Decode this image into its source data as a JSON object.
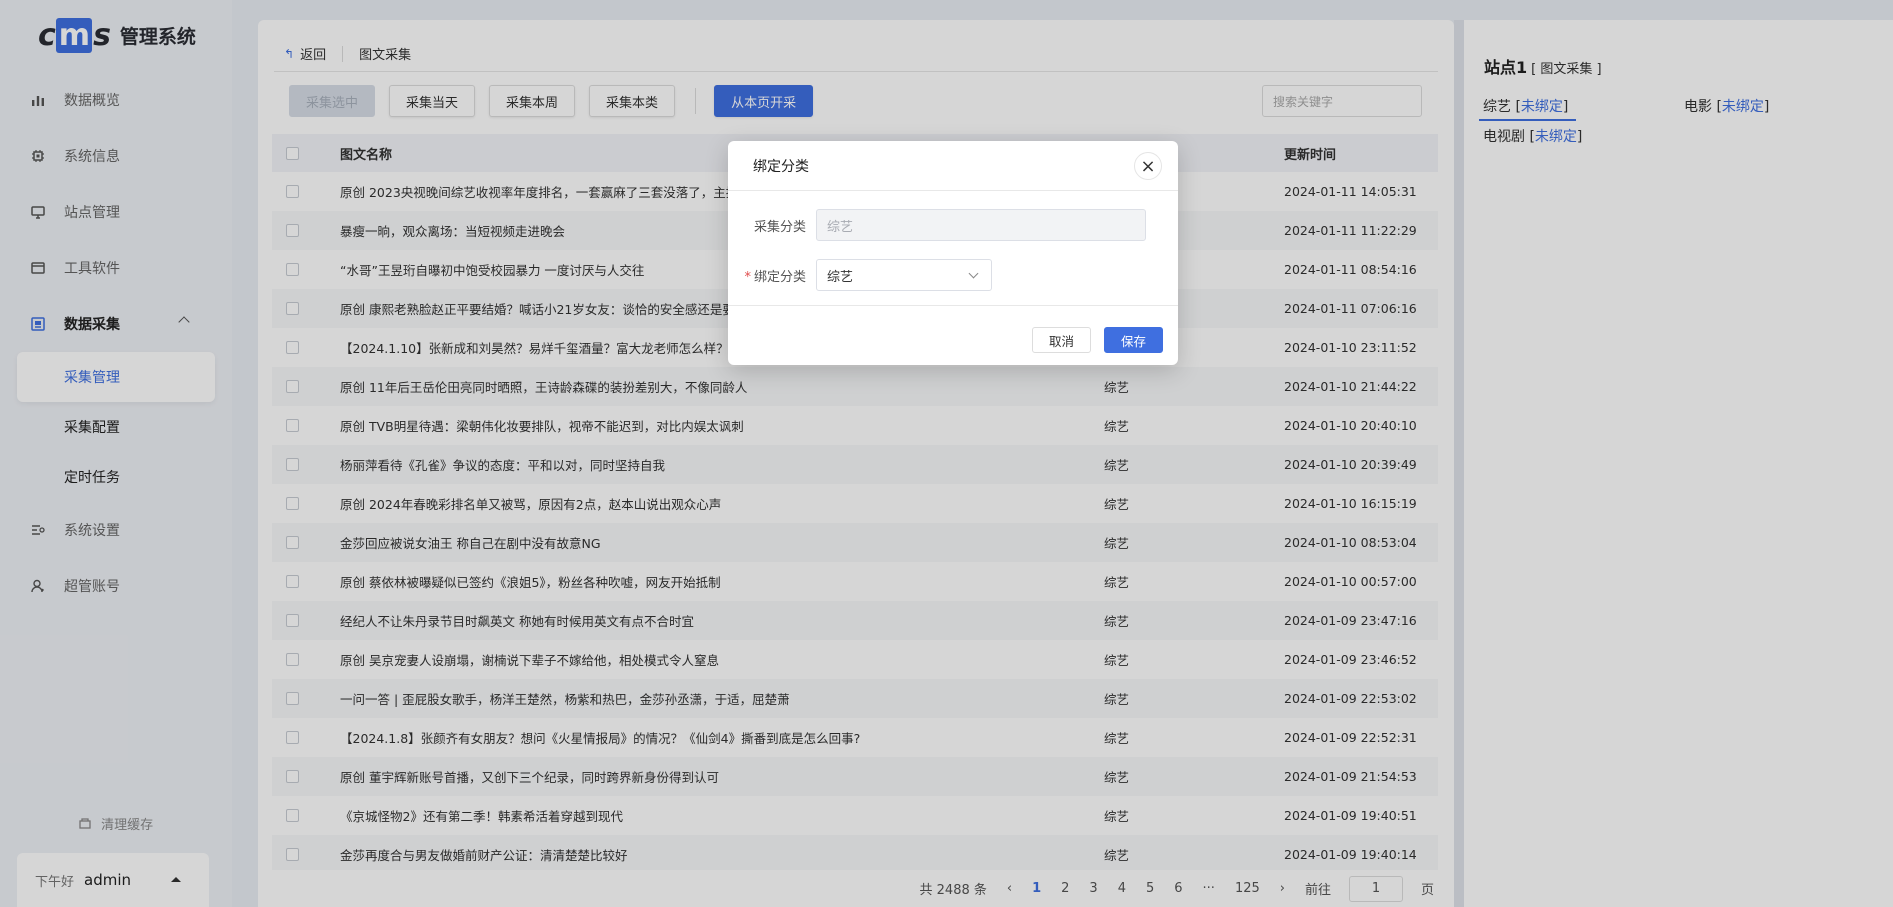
{
  "app": {
    "logo_text": "cms",
    "title": "管理系统"
  },
  "sidebar": {
    "items": [
      {
        "label": "数据概览",
        "icon": "bar-chart-icon"
      },
      {
        "label": "系统信息",
        "icon": "chip-icon"
      },
      {
        "label": "站点管理",
        "icon": "monitor-icon"
      },
      {
        "label": "工具软件",
        "icon": "window-icon"
      },
      {
        "label": "数据采集",
        "icon": "collect-icon"
      },
      {
        "label": "系统设置",
        "icon": "settings-icon"
      },
      {
        "label": "超管账号",
        "icon": "user-icon"
      }
    ],
    "sub_items": [
      {
        "label": "采集管理"
      },
      {
        "label": "采集配置"
      },
      {
        "label": "定时任务"
      }
    ],
    "clear_cache": "清理缓存",
    "greeting": "下午好",
    "username": "admin"
  },
  "main": {
    "back_label": "返回",
    "breadcrumb": "图文采集",
    "toolbar": {
      "btn_selected": "采集选中",
      "btn_today": "采集当天",
      "btn_week": "采集本周",
      "btn_category": "采集本类",
      "btn_from_page": "从本页开采",
      "search_placeholder": "搜索关键字"
    },
    "table": {
      "headers": {
        "name": "图文名称",
        "category": "",
        "time": "更新时间"
      },
      "rows": [
        {
          "name": "原创 2023央视晚间综艺收视率年度排名，一套赢麻了三套没落了，主持人",
          "category": "",
          "time": "2024-01-11 14:05:31"
        },
        {
          "name": "暴瘦一晌，观众离场：当短视频走进晚会",
          "category": "",
          "time": "2024-01-11 11:22:29"
        },
        {
          "name": "“水哥”王昱珩自曝初中饱受校园暴力 一度讨厌与人交往",
          "category": "",
          "time": "2024-01-11 08:54:16"
        },
        {
          "name": "原创 康熙老熟脸赵正平要结婚？喊话小21岁女友：谈恰的安全感还是要的",
          "category": "",
          "time": "2024-01-11 07:06:16"
        },
        {
          "name": "【2024.1.10】张新成和刘昊然？易烊千玺酒量？富大龙老师怎么样？开心",
          "category": "",
          "time": "2024-01-10 23:11:52"
        },
        {
          "name": "原创 11年后王岳伦田亮同时晒照，王诗龄森碟的装扮差别大，不像同龄人",
          "category": "综艺",
          "time": "2024-01-10 21:44:22"
        },
        {
          "name": "原创 TVB明星待遇：梁朝伟化妆要排队，视帝不能迟到，对比内娱太讽刺",
          "category": "综艺",
          "time": "2024-01-10 20:40:10"
        },
        {
          "name": "杨丽萍看待《孔雀》争议的态度：平和以对，同时坚持自我",
          "category": "综艺",
          "time": "2024-01-10 20:39:49"
        },
        {
          "name": "原创 2024年春晚彩排名单又被骂，原因有2点，赵本山说出观众心声",
          "category": "综艺",
          "time": "2024-01-10 16:15:19"
        },
        {
          "name": "金莎回应被说女油王 称自己在剧中没有故意NG",
          "category": "综艺",
          "time": "2024-01-10 08:53:04"
        },
        {
          "name": "原创 蔡依林被曝疑似已签约《浪姐5》，粉丝各种吹嘘，网友开始抵制",
          "category": "综艺",
          "time": "2024-01-10 00:57:00"
        },
        {
          "name": "经纪人不让朱丹录节目时飙英文 称她有时候用英文有点不合时宜",
          "category": "综艺",
          "time": "2024-01-09 23:47:16"
        },
        {
          "name": "原创 吴京宠妻人设崩塌，谢楠说下辈子不嫁给他，相处模式令人窒息",
          "category": "综艺",
          "time": "2024-01-09 23:46:52"
        },
        {
          "name": "一问一答 | 歪屁股女歌手，杨洋王楚然，杨紫和热巴，金莎孙丞潇，于适，屈楚萧",
          "category": "综艺",
          "time": "2024-01-09 22:53:02"
        },
        {
          "name": "【2024.1.8】张颜齐有女朋友？想问《火星情报局》的情况？《仙剑4》撕番到底是怎么回事?",
          "category": "综艺",
          "time": "2024-01-09 22:52:31"
        },
        {
          "name": "原创 董宇辉新账号首播，又创下三个纪录，同时跨界新身份得到认可",
          "category": "综艺",
          "time": "2024-01-09 21:54:53"
        },
        {
          "name": "《京城怪物2》还有第二季！韩素希活着穿越到现代",
          "category": "综艺",
          "time": "2024-01-09 19:40:51"
        },
        {
          "name": "金莎再度合与男友做婚前财产公证：清清楚楚比较好",
          "category": "综艺",
          "time": "2024-01-09 19:40:14"
        }
      ]
    },
    "pagination": {
      "total": "共 2488 条",
      "pages": [
        "1",
        "2",
        "3",
        "4",
        "5",
        "6",
        "···",
        "125"
      ],
      "current": "1",
      "goto_label": "前往",
      "goto_value": "1",
      "page_suffix": "页"
    }
  },
  "right_panel": {
    "title": "站点1",
    "title_suffix": "[ 图文采集 ]",
    "categories": [
      {
        "name": "综艺",
        "status": "未绑定"
      },
      {
        "name": "电影",
        "status": "未绑定"
      },
      {
        "name": "电视剧",
        "status": "未绑定"
      }
    ]
  },
  "modal": {
    "title": "绑定分类",
    "field1_label": "采集分类",
    "field1_value": "综艺",
    "field2_label": "绑定分类",
    "field2_value": "综艺",
    "cancel": "取消",
    "save": "保存"
  },
  "colors": {
    "accent": "#3f6fe0",
    "required": "#e04b4b"
  }
}
